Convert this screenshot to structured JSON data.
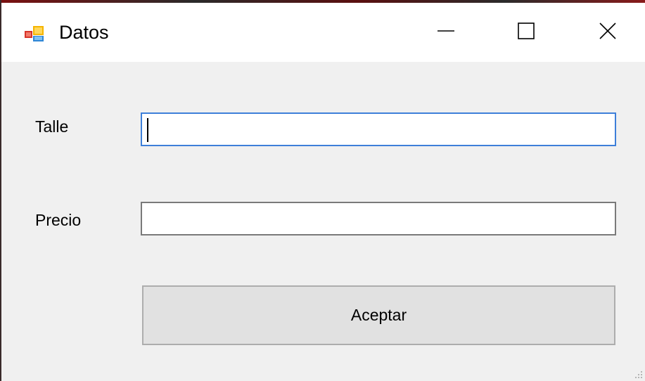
{
  "window": {
    "title": "Datos",
    "app_icon": "windows-form-icon",
    "controls": {
      "minimize_icon": "minimize-icon",
      "maximize_icon": "maximize-icon",
      "close_icon": "close-icon"
    }
  },
  "form": {
    "talle": {
      "label": "Talle",
      "value": "",
      "focused": true
    },
    "precio": {
      "label": "Precio",
      "value": ""
    },
    "accept_label": "Aceptar"
  },
  "colors": {
    "window_bg": "#f0f0f0",
    "titlebar_bg": "#ffffff",
    "focus_border": "#3d7fd9",
    "textbox_border": "#7a7a7a",
    "button_bg": "#e1e1e1",
    "button_border": "#adadad"
  }
}
